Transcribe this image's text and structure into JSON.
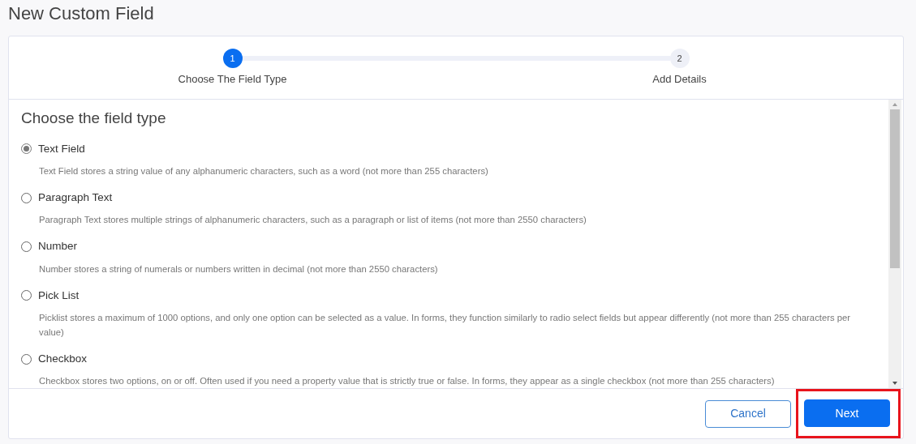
{
  "page_title": "New Custom Field",
  "steps": [
    {
      "number": "1",
      "label": "Choose The Field Type",
      "selected": true
    },
    {
      "number": "2",
      "label": "Add Details",
      "selected": false
    }
  ],
  "section_title": "Choose the field type",
  "options": [
    {
      "label": "Text Field",
      "description": "Text Field stores a string value of any alphanumeric characters, such as a word (not more than 255 characters)",
      "selected": true
    },
    {
      "label": "Paragraph Text",
      "description": "Paragraph Text stores multiple strings of alphanumeric characters, such as a paragraph or list of items (not more than 2550 characters)",
      "selected": false
    },
    {
      "label": "Number",
      "description": "Number stores a string of numerals or numbers written in decimal (not more than 2550 characters)",
      "selected": false
    },
    {
      "label": "Pick List",
      "description": "Picklist stores a maximum of 1000 options, and only one option can be selected as a value. In forms, they function similarly to radio select fields but appear differently (not more than 255 characters per value)",
      "selected": false
    },
    {
      "label": "Checkbox",
      "description": "Checkbox stores two options, on or off. Often used if you need a property value that is strictly true or false. In forms, they appear as a single checkbox (not more than 255 characters)",
      "selected": false
    }
  ],
  "buttons": [
    {
      "label": "Cancel",
      "kind": "secondary",
      "highlighted": false
    },
    {
      "label": "Next",
      "kind": "primary",
      "highlighted": true
    }
  ]
}
